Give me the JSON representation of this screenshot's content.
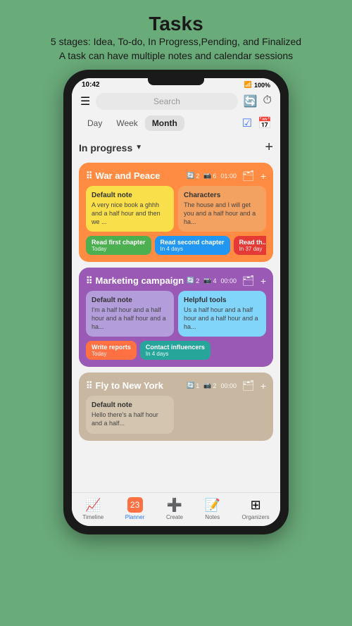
{
  "header": {
    "title": "Tasks",
    "subtitle_line1": "5 stages: Idea, To-do, In Progress,Pending, and Finalized",
    "subtitle_line2": "A task can have multiple notes and calendar sessions"
  },
  "status_bar": {
    "time": "10:42",
    "battery": "100%"
  },
  "top_bar": {
    "search_placeholder": "Search"
  },
  "period_tabs": [
    {
      "label": "Day",
      "active": false
    },
    {
      "label": "Week",
      "active": false
    },
    {
      "label": "Month",
      "active": true
    }
  ],
  "section": {
    "title": "In progress",
    "add_label": "+"
  },
  "tasks": [
    {
      "id": "war-peace",
      "title": "War and Peace",
      "meta": {
        "notes": "2",
        "sessions": "6",
        "time": "01:00"
      },
      "color": "orange",
      "notes": [
        {
          "id": "default-note-1",
          "title": "Default note",
          "body": "A very nice book a ghhh and a half hour and then we ...",
          "color": "yellow"
        },
        {
          "id": "characters",
          "title": "Characters",
          "body": "The house and I will get you and a half hour and a ha...",
          "color": "salmon"
        }
      ],
      "chips": [
        {
          "label": "Read first chapter",
          "sub": "Today",
          "color": "chip-green"
        },
        {
          "label": "Read second chapter",
          "sub": "In 4 days",
          "color": "chip-blue"
        },
        {
          "label": "Read th...",
          "sub": "In 37 day",
          "color": "chip-red"
        }
      ]
    },
    {
      "id": "marketing",
      "title": "Marketing campaign",
      "meta": {
        "notes": "2",
        "sessions": "4",
        "time": "00:00"
      },
      "color": "purple",
      "notes": [
        {
          "id": "default-note-2",
          "title": "Default note",
          "body": "I'm a half hour and a half hour and a half hour and a ha...",
          "color": "light-purple"
        },
        {
          "id": "helpful-tools",
          "title": "Helpful tools",
          "body": "Us a half hour and a half hour and a half hour and a ha...",
          "color": "light-blue"
        }
      ],
      "chips": [
        {
          "label": "Write reports",
          "sub": "Today",
          "color": "chip-orange"
        },
        {
          "label": "Contact influencers",
          "sub": "In 4 days",
          "color": "chip-teal"
        }
      ]
    },
    {
      "id": "fly-newyork",
      "title": "Fly to New York",
      "meta": {
        "notes": "1",
        "sessions": "2",
        "time": "00:00"
      },
      "color": "tan",
      "notes": [
        {
          "id": "default-note-3",
          "title": "Default note",
          "body": "Hello there's a half hour and a half...",
          "color": "tan-light"
        }
      ],
      "chips": []
    }
  ],
  "bottom_nav": [
    {
      "id": "timeline",
      "label": "Timeline",
      "icon": "📈",
      "active": false
    },
    {
      "id": "planner",
      "label": "Planner",
      "icon": "📅",
      "active": true
    },
    {
      "id": "create",
      "label": "Create",
      "icon": "➕",
      "active": false
    },
    {
      "id": "notes",
      "label": "Notes",
      "icon": "📝",
      "active": false
    },
    {
      "id": "organizers",
      "label": "Organizers",
      "icon": "⊞",
      "active": false
    }
  ]
}
